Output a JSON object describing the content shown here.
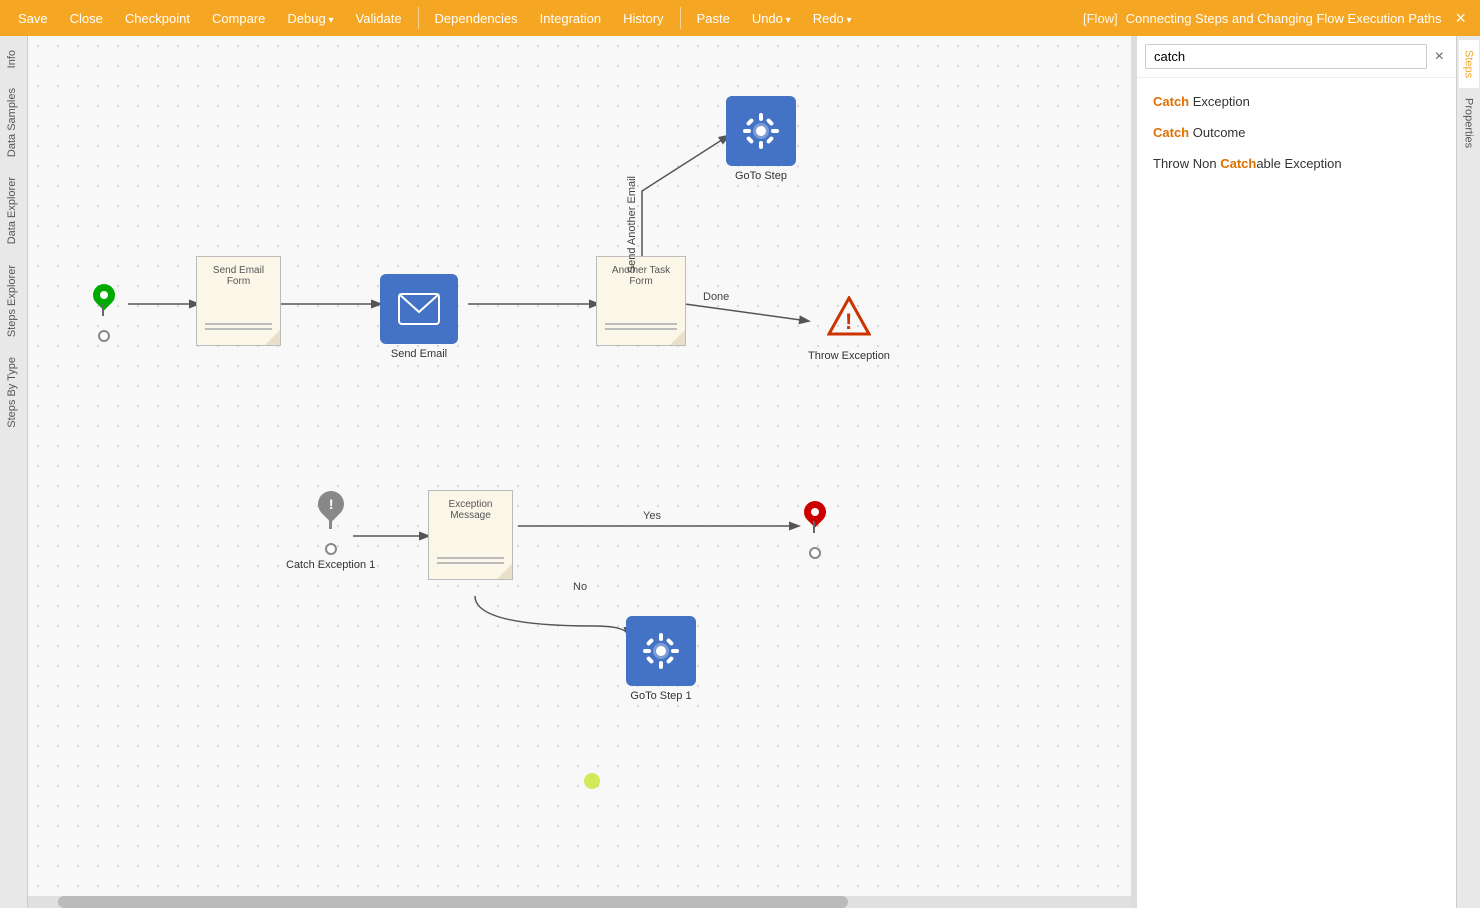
{
  "toolbar": {
    "save_label": "Save",
    "close_label": "Close",
    "checkpoint_label": "Checkpoint",
    "compare_label": "Compare",
    "debug_label": "Debug",
    "validate_label": "Validate",
    "dependencies_label": "Dependencies",
    "integration_label": "Integration",
    "history_label": "History",
    "paste_label": "Paste",
    "undo_label": "Undo",
    "redo_label": "Redo",
    "flow_label": "[Flow]",
    "flow_title": "Connecting Steps and Changing Flow Execution Paths"
  },
  "left_tabs": {
    "info": "Info",
    "data_samples": "Data Samples",
    "data_explorer": "Data Explorer",
    "steps_explorer": "Steps Explorer",
    "steps_by_type": "Steps By Type"
  },
  "right_tabs": {
    "steps": "Steps",
    "properties": "Properties"
  },
  "search": {
    "placeholder": "catch",
    "value": "catch",
    "clear_label": "×"
  },
  "search_results": [
    {
      "prefix": "",
      "highlight": "Catch",
      "suffix": " Exception"
    },
    {
      "prefix": "",
      "highlight": "Catch",
      "suffix": " Outcome"
    },
    {
      "prefix": "Throw Non ",
      "highlight": "Catch",
      "suffix": "able Exception"
    }
  ],
  "nodes": {
    "start_pin": {
      "label": ""
    },
    "send_email_form": {
      "label": "Send Email\nForm",
      "line1": "",
      "line2": ""
    },
    "send_email": {
      "label": "Send Email"
    },
    "another_task_form": {
      "label": "Another Task\nForm",
      "line1": "",
      "line2": ""
    },
    "goto_step": {
      "label": "GoTo Step"
    },
    "throw_exception": {
      "label": "Throw Exception"
    },
    "catch_exception_1": {
      "label": "Catch Exception 1"
    },
    "exception_message": {
      "label": "Exception\nMessage",
      "line1": "",
      "line2": ""
    },
    "end_pin": {
      "label": ""
    },
    "goto_step_1": {
      "label": "GoTo Step 1"
    }
  },
  "edge_labels": {
    "send_another_email": "Send Another Email",
    "done": "Done",
    "yes": "Yes",
    "no": "No"
  },
  "colors": {
    "orange": "#f5a623",
    "blue": "#4472c4",
    "green": "#00aa00",
    "red": "#cc0000",
    "warning_red": "#cc3300",
    "highlight": "#e07000"
  }
}
